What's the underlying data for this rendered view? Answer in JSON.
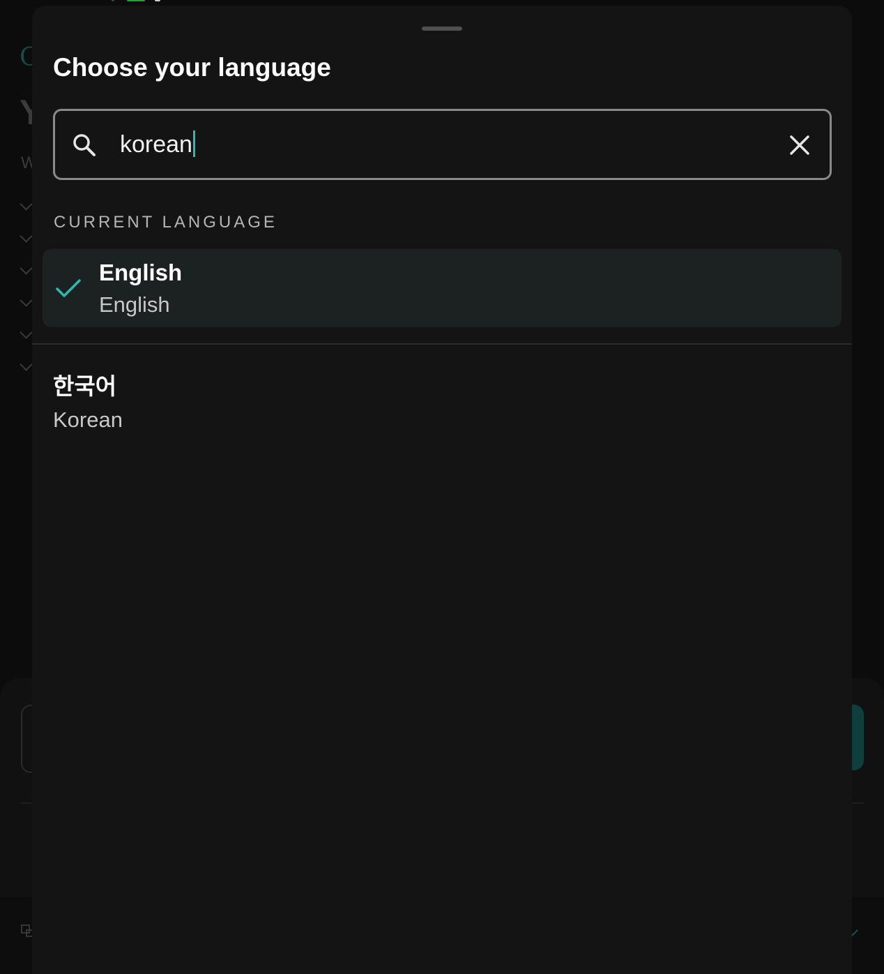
{
  "sheet": {
    "title": "Choose your language"
  },
  "search": {
    "value": "korean",
    "search_icon": "search-icon",
    "clear_icon": "close-icon"
  },
  "current_section": {
    "label": "CURRENT LANGUAGE",
    "selected": {
      "native_name": "English",
      "english_name": "English",
      "icon": "check-icon"
    }
  },
  "results": [
    {
      "native_name": "한국어",
      "english_name": "Korean"
    }
  ],
  "background": {
    "logo_fragment": "C",
    "title_fragment": "Y",
    "subtitle_fragment": "W"
  },
  "colors": {
    "accent": "#2fb9b1",
    "sheet_background": "#141414",
    "selected_row_background": "#1b2221",
    "search_border": "#8a8a8a"
  }
}
